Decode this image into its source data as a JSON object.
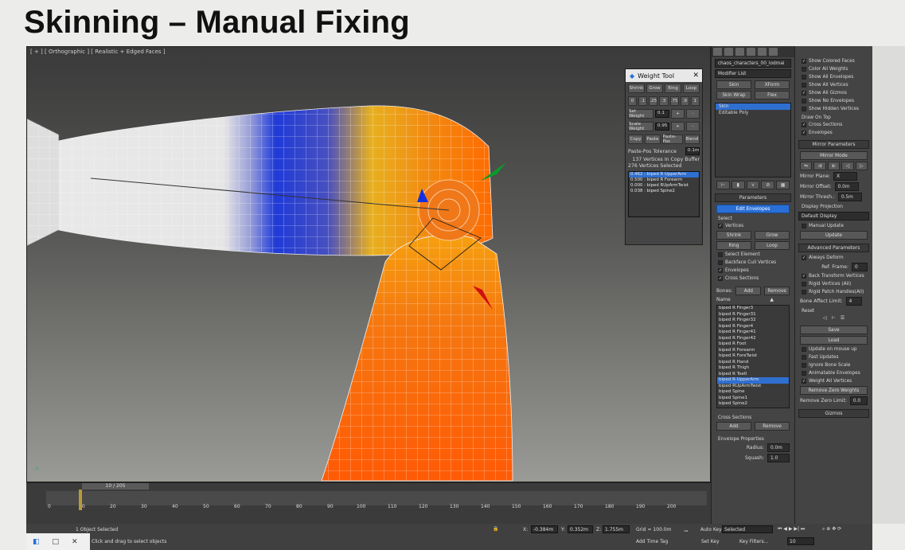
{
  "slide": {
    "title": "Skinning – Manual Fixing"
  },
  "viewport": {
    "label": "[ + ] [ Orthographic ] [ Realistic + Edged Faces ]"
  },
  "weight_tool": {
    "title": "Weight Tool",
    "ops": [
      "Shrink",
      "Grow",
      "Ring",
      "Loop"
    ],
    "presets": [
      "0",
      ".1",
      ".25",
      ".5",
      ".75",
      ".9",
      "1"
    ],
    "set_weight_label": "Set Weight",
    "set_weight_value": "0.1",
    "scale_weight_label": "Scale Weight",
    "scale_weight_value": "0.95",
    "clip_ops": [
      "Copy",
      "Paste",
      "Paste-Pos",
      "Blend"
    ],
    "paste_tol_label": "Paste-Pos Tolerance",
    "paste_tol_value": "0.1m",
    "copy_info": "137 Vertices In Copy Buffer",
    "selected_info": "276 Vertices Selected",
    "weights": [
      "0.462 : biped R UpperArm",
      "0.500 : biped R Forearm",
      "0.000 : biped RUpArmTwist",
      "0.038 : biped Spine2"
    ]
  },
  "modify_panel": {
    "object_name": "chaos_characters_00_lodmai",
    "modifier_list": "Modifier List",
    "mod_buttons": [
      "Skin",
      "XForm",
      "Skin Wrap",
      "Flex"
    ],
    "stack": [
      "Skin",
      "Editable Poly"
    ],
    "params_title": "Parameters",
    "edit_envelopes": "Edit Envelopes",
    "select_label": "Select",
    "vertices": "Vertices",
    "sel_ops": [
      "Shrink",
      "Grow",
      "Ring",
      "Loop"
    ],
    "checks": [
      "Select Element",
      "Backface Cull Vertices",
      "Envelopes",
      "Cross Sections"
    ],
    "bones_label": "Bones:",
    "add": "Add",
    "remove": "Remove",
    "name_label": "Name",
    "bones": [
      "biped R Finger3",
      "biped R Finger31",
      "biped R Finger32",
      "biped R Finger4",
      "biped R Finger41",
      "biped R Finger42",
      "biped R Foot",
      "biped R Forearm",
      "biped R ForeTwist",
      "biped R Hand",
      "biped R Thigh",
      "biped R Toe0",
      "biped R UpperArm",
      "biped RUpArmTwist",
      "biped Spine",
      "biped Spine1",
      "biped Spine2"
    ],
    "cross_sections": "Cross Sections",
    "env_props": "Envelope Properties",
    "radius_label": "Radius:",
    "radius_value": "0.0m",
    "squash_label": "Squash:",
    "squash_value": "1.0"
  },
  "display_panel": {
    "checks": [
      "Show Colored Faces",
      "Color All Weights",
      "Show All Envelopes",
      "Show All Vertices",
      "Show All Gizmos",
      "Show No Envelopes",
      "Show Hidden Vertices"
    ],
    "draw_on_top": "Draw On Top",
    "draw_checks": [
      "Cross Sections",
      "Envelopes"
    ],
    "mirror_title": "Mirror Parameters",
    "mirror_mode": "Mirror Mode",
    "mirror_plane_label": "Mirror Plane:",
    "mirror_plane_value": "X",
    "mirror_offset_label": "Mirror Offset:",
    "mirror_offset_value": "0.0m",
    "mirror_thresh_label": "Mirror Thresh.:",
    "mirror_thresh_value": "0.5m",
    "display_projection": "Display Projection",
    "default_display": "Default Display",
    "manual_update": "Manual Update",
    "update": "Update",
    "adv_title": "Advanced Parameters",
    "always_deform": "Always Deform",
    "ref_frame_label": "Ref. Frame:",
    "ref_frame_value": "0",
    "adv_checks": [
      "Back Transform Vertices",
      "Rigid Vertices (All)",
      "Rigid Patch Handles(All)"
    ],
    "bone_affect_label": "Bone Affect Limit:",
    "bone_affect_value": "4",
    "reset": "Reset",
    "save": "Save",
    "load": "Load",
    "adv_checks2": [
      "Update on mouse up",
      "Fast Updates",
      "Ignore Bone Scale",
      "Animatable Envelopes",
      "Weight All Vertices"
    ],
    "remove_zero": "Remove Zero Weights",
    "remove_zero_limit_label": "Remove Zero Limit:",
    "remove_zero_limit_value": "0.0",
    "gizmos": "Gizmos"
  },
  "timeline": {
    "frame": "10 / 205",
    "ticks": [
      "0",
      "10",
      "20",
      "30",
      "40",
      "50",
      "60",
      "70",
      "80",
      "90",
      "100",
      "110",
      "120",
      "130",
      "140",
      "150",
      "160",
      "170",
      "180",
      "190",
      "200"
    ]
  },
  "status": {
    "selection": "1 Object Selected",
    "prompt": "Click and drag to select objects",
    "x_label": "X:",
    "x_value": "-0.384m",
    "y_label": "Y:",
    "y_value": "0.352m",
    "z_label": "Z:",
    "z_value": "1.755m",
    "grid": "Grid = 100.0m",
    "add_time_tag": "Add Time Tag",
    "auto_key": "Auto Key",
    "auto_key_value": "Selected",
    "set_key": "Set Key",
    "key_filters": "Key Filters...",
    "frame_field": "10"
  }
}
